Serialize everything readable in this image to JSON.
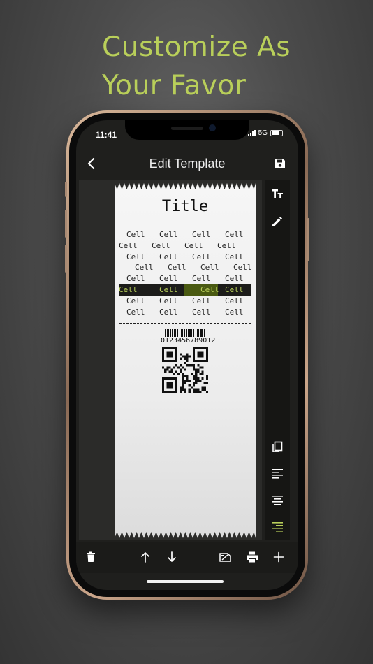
{
  "promo": {
    "headline_line1": "Customize As",
    "headline_line2": "Your Favor"
  },
  "status_bar": {
    "time": "11:41",
    "network": "5G"
  },
  "nav": {
    "title": "Edit Template",
    "back_icon": "chevron-left-icon",
    "save_icon": "save-icon"
  },
  "receipt": {
    "title": "Title",
    "rows": [
      [
        "Cell",
        "Cell",
        "Cell",
        "Cell"
      ],
      [
        "Cell",
        "Cell",
        "Cell",
        "Cell"
      ],
      [
        "Cell",
        "Cell",
        "Cell",
        "Cell"
      ],
      [
        "Cell",
        "Cell",
        "Cell",
        "Cell"
      ],
      [
        "Cell",
        "Cell",
        "Cell",
        "Cell"
      ],
      [
        "Cell",
        "Cell",
        "Cell",
        "Cell"
      ],
      [
        "Cell",
        "Cell",
        "Cell",
        "Cell"
      ],
      [
        "Cell",
        "Cell",
        "Cell",
        "Cell"
      ]
    ],
    "highlighted_row": 5,
    "barcode_value": "0123456789012"
  },
  "side_tools": [
    "text-size-icon",
    "pencil-icon",
    "copy-icon",
    "align-left-icon",
    "align-center-icon",
    "align-right-icon"
  ],
  "bottom_tools": [
    "trash-icon",
    "arrow-up-icon",
    "arrow-down-icon",
    "print-preview-icon",
    "print-icon",
    "plus-icon"
  ],
  "colors": {
    "accent": "#b9cf5a",
    "screen_bg": "#1f1f1d",
    "paper": "#f2f2f2"
  }
}
